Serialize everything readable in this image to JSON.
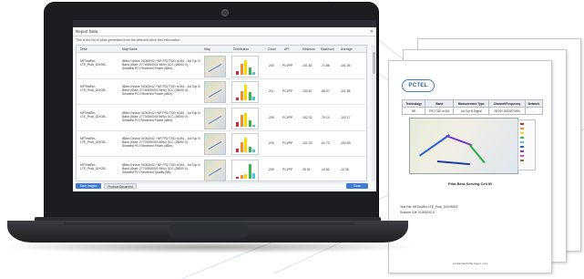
{
  "dialog": {
    "title": "Report Data",
    "close_glyph": "✕",
    "subtitle": "This is the list of plots generated from the selected drive test information",
    "columns": [
      "Drive",
      "Map Name",
      "Map",
      "Distribution",
      "Count",
      "API",
      "Minimum",
      "Maximum",
      "Average"
    ],
    "rows": [
      {
        "drive": "MFTestRm-LTE_Prob_DIXOB...",
        "map_name": "IBflex Device 01063042 / NR FR2 TDD nr261 - 1st Top N Band (Start: 27700000000 MHz) 3CC (28000 0) - Smallest PCI Received Power (dBm)",
        "count": "205",
        "api": "PCI/PP",
        "min": "-101.82",
        "max": "-71.88",
        "avg": "-101.05"
      },
      {
        "drive": "MFTestRm-LTE_Prob_DIXOB...",
        "map_name": "IBflex Device 01063042 / NR FR2 TDD nr261 - 1st Top N Band (Start: 27700000000 MHz) 3CC (28000 0) - Smallest PCI Received Power (dBm)",
        "count": "211",
        "api": "PCI/PP",
        "min": "-103.87",
        "max": "-68.97",
        "avg": "-101.86"
      },
      {
        "drive": "MFTestRm-LTE_Prob_DIXOB...",
        "map_name": "IBflex Device 01063042 / NR FR2 TDD nr261 - 1st Top N Band (Start: 27700000000 MHz) 3CC (28000 0) - Smallest PCI Received Power (dBm)",
        "count": "205",
        "api": "PCI/PP",
        "min": "-102.32",
        "max": "-79.14",
        "avg": "-102.17"
      },
      {
        "drive": "MFTestRm-LTE_Prob_DIXOB...",
        "map_name": "IBflex Device 01063042 / NR FR2 TDD nr261 - 1st Top N Band (Start: 27700000000 MHz) 3CC (28000 0) - Smallest PCI Received Power (dBm)",
        "count": "205",
        "api": "PCI/PP",
        "min": "-101.33",
        "max": "-61.73",
        "avg": "-100.83"
      },
      {
        "drive": "MFTestRm-LTE_Prob_DIXOB...",
        "map_name": "IBflex Device 01063042 / NR FR2 TDD nr261 - 1st Top N Band (Start: 27700000000 MHz) 3CC (28000 0) - Smallest PCI Received Quality (dB)",
        "count": "205",
        "api": "PCI/PP",
        "min": "-25.91",
        "max": "-10.82",
        "avg": "-12.35"
      }
    ],
    "buttons": {
      "save_images": "Save Images",
      "produce_document": "Produce Document",
      "close": "Close"
    }
  },
  "report": {
    "logo_text": "PCTEL",
    "table_headers": [
      "Technology",
      "Band",
      "Measurement Type",
      "Channel/Frequency",
      "Network"
    ],
    "table_row": [
      "NR",
      "FR2 TDD nr261",
      "1st Top N Signal",
      "28 000 000000 MHz",
      "-"
    ],
    "caption": "Pilot Best-Serving Cell ID",
    "test_file": "Test File: MFTestRm-LTE_Prob_DIXOB003",
    "scanner_id": "Scanner ID#: 01063042-0",
    "footer": "Confidential PCTEL  Page 1 of 12"
  },
  "colors": {
    "accent": "#3d7bd4",
    "brand": "#2f5f92"
  }
}
